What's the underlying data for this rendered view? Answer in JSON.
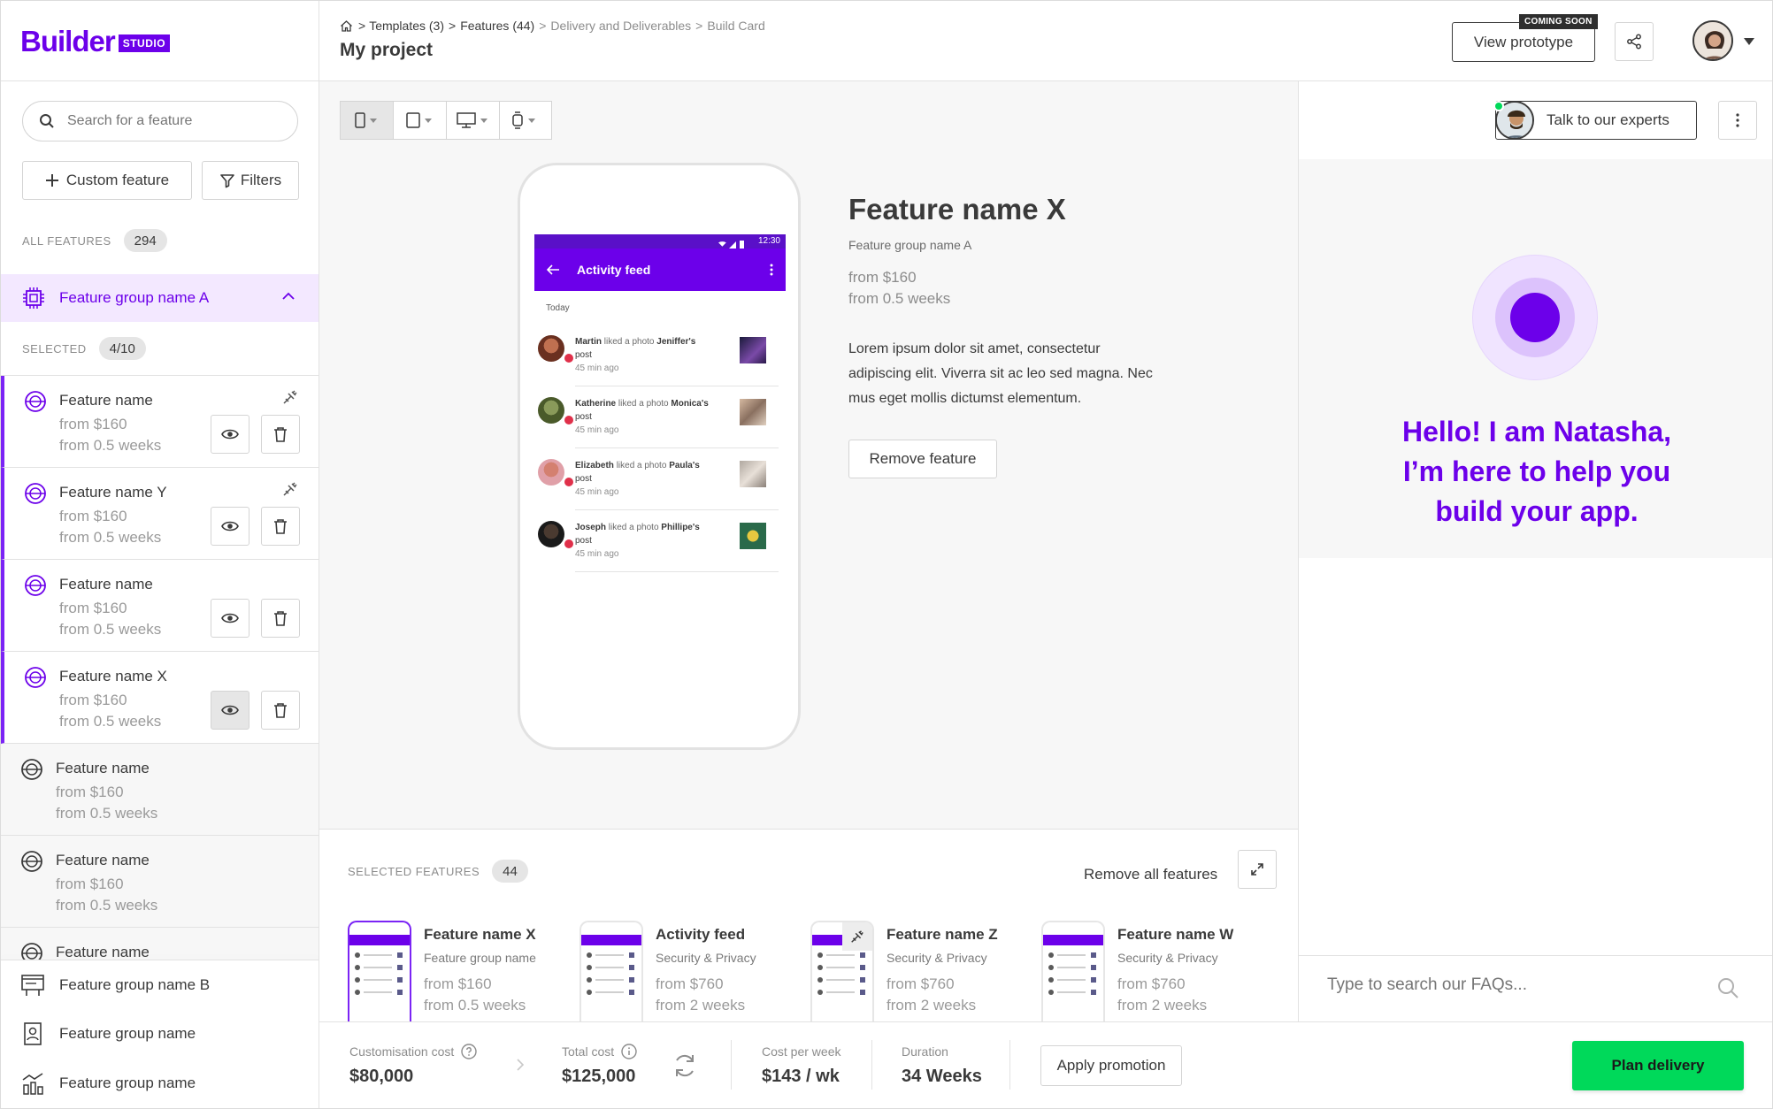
{
  "brand": {
    "logo_text": "Builder",
    "logo_badge": "STUDIO",
    "accent": "#6c00ea",
    "green": "#00d95a"
  },
  "header": {
    "breadcrumb": {
      "templates": "Templates (3)",
      "features": "Features (44)",
      "delivery": "Delivery and Deliverables",
      "build_card": "Build Card",
      "sep": ">"
    },
    "title": "My project",
    "view_prototype": "View prototype",
    "coming_soon": "COMING SOON"
  },
  "sidebar": {
    "search_placeholder": "Search for a feature",
    "custom_feature": "Custom feature",
    "filters": "Filters",
    "all_features_label": "ALL FEATURES",
    "all_features_count": "294",
    "group_a": "Feature group name A",
    "selected_label": "SELECTED",
    "selected_count": "4/10",
    "features": [
      {
        "name": "Feature name",
        "price": "from $160",
        "weeks": "from 0.5 weeks"
      },
      {
        "name": "Feature name Y",
        "price": "from $160",
        "weeks": "from 0.5 weeks"
      },
      {
        "name": "Feature name",
        "price": "from $160",
        "weeks": "from 0.5 weeks"
      },
      {
        "name": "Feature name X",
        "price": "from $160",
        "weeks": "from 0.5 weeks"
      },
      {
        "name": "Feature name",
        "price": "from $160",
        "weeks": "from 0.5 weeks"
      },
      {
        "name": "Feature name",
        "price": "from $160",
        "weeks": "from 0.5 weeks"
      },
      {
        "name": "Feature name"
      }
    ],
    "group_b": "Feature group name B",
    "group_c": "Feature group name",
    "group_d": "Feature group name"
  },
  "phone": {
    "time": "12:30",
    "screen_title": "Activity feed",
    "today": "Today",
    "items": [
      {
        "user": "Martin",
        "action": "liked a photo",
        "target": "Jeniffer's",
        "post": "post",
        "time": "45 min ago"
      },
      {
        "user": "Katherine",
        "action": "liked a photo",
        "target": "Monica's",
        "post": "post",
        "time": "45 min ago"
      },
      {
        "user": "Elizabeth",
        "action": "liked a photo",
        "target": "Paula's",
        "post": "post",
        "time": "45 min ago"
      },
      {
        "user": "Joseph",
        "action": "liked a photo",
        "target": "Phillipe's",
        "post": "post",
        "time": "45 min ago"
      }
    ]
  },
  "detail": {
    "title": "Feature name X",
    "group": "Feature group name A",
    "price": "from $160",
    "weeks": "from 0.5 weeks",
    "description": "Lorem ipsum dolor sit amet, consectetur adipiscing elit. Viverra sit ac leo sed magna. Nec mus eget mollis dictumst elementum.",
    "remove": "Remove feature"
  },
  "selected_panel": {
    "label": "SELECTED FEATURES",
    "count": "44",
    "remove_all": "Remove all features",
    "cards": [
      {
        "name": "Feature name X",
        "group": "Feature group name",
        "price": "from $160",
        "weeks": "from 0.5 weeks"
      },
      {
        "name": "Activity feed",
        "group": "Security & Privacy",
        "price": "from $760",
        "weeks": "from 2 weeks"
      },
      {
        "name": "Feature name Z",
        "group": "Security & Privacy",
        "price": "from $760",
        "weeks": "from 2 weeks"
      },
      {
        "name": "Feature name W",
        "group": "Security & Privacy",
        "price": "from $760",
        "weeks": "from 2 weeks"
      }
    ]
  },
  "footer": {
    "customisation_label": "Customisation cost",
    "customisation_value": "$80,000",
    "total_label": "Total cost",
    "total_value": "$125,000",
    "week_label": "Cost per week",
    "week_value": "$143 / wk",
    "duration_label": "Duration",
    "duration_value": "34 Weeks",
    "apply_promotion": "Apply promotion",
    "plan_delivery": "Plan delivery"
  },
  "assistant": {
    "talk": "Talk to our experts",
    "greeting_1": "Hello! I am Natasha,",
    "greeting_2": "I’m here to help you",
    "greeting_3": "build your app.",
    "faq_placeholder": "Type to search our FAQs..."
  }
}
